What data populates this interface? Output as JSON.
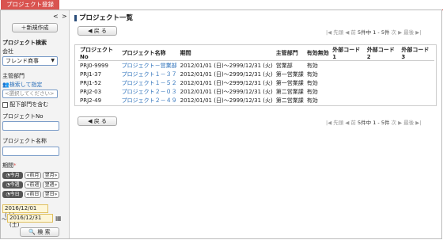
{
  "tab": {
    "label": "プロジェクト登録"
  },
  "sidebar": {
    "nav_prev": "<",
    "nav_next": ">",
    "new_button": "＋新規作成",
    "search_title": "プロジェクト検索",
    "company_label": "会社",
    "company_value": "フレンド商事",
    "dept_label": "主管部門",
    "dept_link": "検索して指定",
    "dept_placeholder": "<選択してください>",
    "include_sub_label": "配下部門を含む",
    "project_no_label": "プロジェクトNo",
    "project_name_label": "プロジェクト名称",
    "period_label": "期間",
    "period_required": "*",
    "row1": [
      "今月",
      "前月",
      "翌月"
    ],
    "row2": [
      "今週",
      "前週",
      "翌週"
    ],
    "row3": [
      "今日",
      "前日",
      "翌日"
    ],
    "date_from": "2016/12/01 (木)",
    "date_tilde": "～",
    "date_to": "2016/12/31 (土)",
    "search_button": "検 索"
  },
  "main": {
    "title": "プロジェクト一覧",
    "back_button": "戻 る",
    "pager": {
      "first": "先頭",
      "prev": "前",
      "status": "5件中 1 - 5件",
      "next": "次",
      "last": "最後"
    },
    "columns": [
      "プロジェクトNo",
      "プロジェクト名称",
      "期間",
      "主管部門",
      "有効無効",
      "外部コード1",
      "外部コード2",
      "外部コード3"
    ],
    "rows": [
      {
        "no": "PRJ0-9999",
        "name": "プロジェクト－営業部",
        "period": "2012/01/01 (日)～2999/12/31 (火)",
        "dept": "営業部",
        "status": "有効"
      },
      {
        "no": "PRJ1-37",
        "name": "プロジェクト１－３７",
        "period": "2012/01/01 (日)～2999/12/31 (火)",
        "dept": "第一営業課",
        "status": "有効"
      },
      {
        "no": "PRJ1-52",
        "name": "プロジェクト１－５２",
        "period": "2012/01/01 (日)～2999/12/31 (火)",
        "dept": "第一営業課",
        "status": "有効"
      },
      {
        "no": "PRJ2-03",
        "name": "プロジェクト２－０３",
        "period": "2012/01/01 (日)～2999/12/31 (火)",
        "dept": "第二営業課",
        "status": "有効"
      },
      {
        "no": "PRJ2-49",
        "name": "プロジェクト２－４９",
        "period": "2012/01/01 (日)～2999/12/31 (火)",
        "dept": "第二営業課",
        "status": "有効"
      }
    ]
  }
}
